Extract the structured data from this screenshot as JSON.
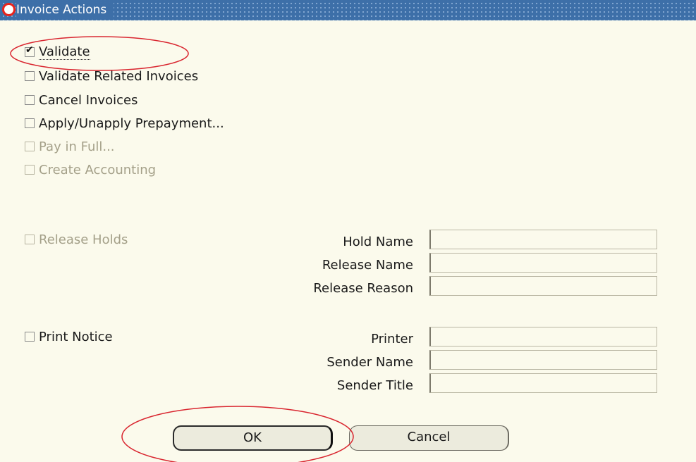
{
  "window": {
    "title": "Invoice Actions",
    "logo_icon": "oracle-logo-icon"
  },
  "actions": [
    {
      "label": "Validate",
      "checked": true,
      "enabled": true
    },
    {
      "label": "Validate Related Invoices",
      "checked": false,
      "enabled": true
    },
    {
      "label": "Cancel Invoices",
      "checked": false,
      "enabled": true
    },
    {
      "label": "Apply/Unapply Prepayment...",
      "checked": false,
      "enabled": true
    },
    {
      "label": "Pay in Full...",
      "checked": false,
      "enabled": false
    },
    {
      "label": "Create Accounting",
      "checked": false,
      "enabled": false
    }
  ],
  "holds": {
    "release_holds_label": "Release Holds",
    "hold_name_label": "Hold Name",
    "release_name_label": "Release Name",
    "release_reason_label": "Release Reason",
    "hold_name_value": "",
    "release_name_value": "",
    "release_reason_value": ""
  },
  "notice": {
    "print_notice_label": "Print Notice",
    "printer_label": "Printer",
    "sender_name_label": "Sender Name",
    "sender_title_label": "Sender Title",
    "printer_value": "",
    "sender_name_value": "",
    "sender_title_value": ""
  },
  "buttons": {
    "ok_label": "OK",
    "cancel_label": "Cancel"
  },
  "colors": {
    "titlebar": "#3d6fa8",
    "background": "#fbfaec",
    "annotation": "#d9252f"
  }
}
